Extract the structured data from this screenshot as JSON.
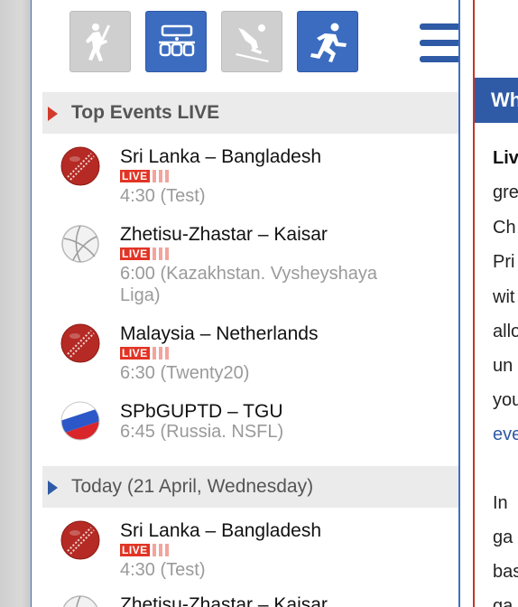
{
  "sports": [
    {
      "name": "cricket",
      "active": false
    },
    {
      "name": "table-soccer",
      "active": true
    },
    {
      "name": "skiing",
      "active": false
    },
    {
      "name": "running",
      "active": true
    }
  ],
  "sections": [
    {
      "title": "Top Events LIVE"
    },
    {
      "title": "Today (21 April, Wednesday)"
    }
  ],
  "live_label": "LIVE",
  "top_events": [
    {
      "teams": "Sri Lanka – Bangladesh",
      "time": "4:30 (Test)",
      "sport": "cricket",
      "live": true
    },
    {
      "teams": "Zhetisu-Zhastar – Kaisar",
      "time": "6:00 (Kazakhstan. Vysheyshaya Liga)",
      "sport": "volleyball",
      "live": true
    },
    {
      "teams": "Malaysia – Netherlands",
      "time": "6:30 (Twenty20)",
      "sport": "cricket",
      "live": true
    },
    {
      "teams": "SPbGUPTD – TGU",
      "time": "6:45 (Russia. NSFL)",
      "sport": "russia-flag-ball",
      "live": false
    }
  ],
  "today_events": [
    {
      "teams": "Sri Lanka – Bangladesh",
      "time": "4:30 (Test)",
      "sport": "cricket",
      "live": true
    },
    {
      "teams": "Zhetisu-Zhastar – Kaisar",
      "time": "",
      "sport": "volleyball",
      "live": false
    }
  ],
  "right_panel": {
    "header": "Wh",
    "lines": [
      "Liv",
      "gre",
      "Ch",
      "Pri",
      "wit",
      "allo",
      "un",
      "you",
      "eve",
      "",
      "In",
      "ga",
      "bas",
      "ga"
    ]
  },
  "colors": {
    "accent": "#2f5aa5",
    "live_red": "#e13425",
    "border_red": "#c9332b"
  }
}
